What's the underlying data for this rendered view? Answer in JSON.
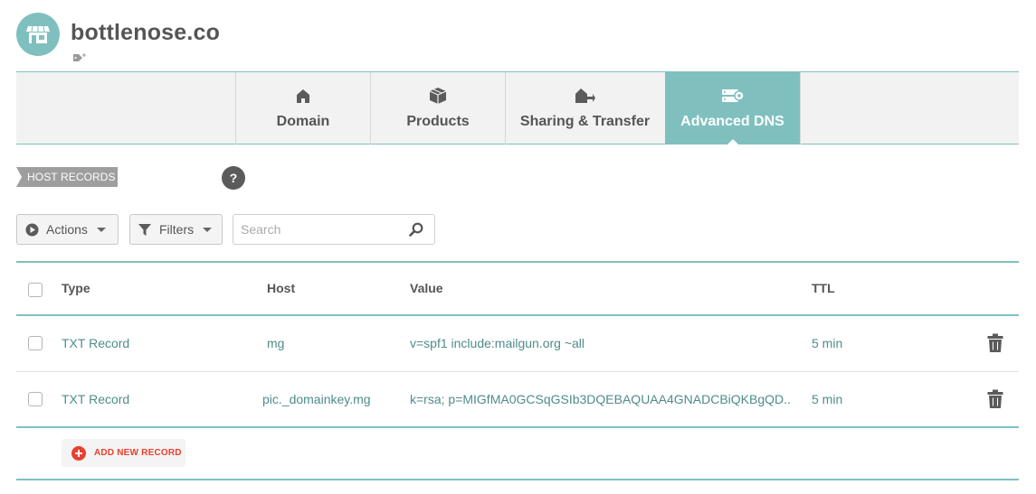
{
  "domain": {
    "name": "bottlenose.co"
  },
  "tabs": [
    {
      "label": "Domain",
      "icon": "home-icon",
      "active": false
    },
    {
      "label": "Products",
      "icon": "box-icon",
      "active": false
    },
    {
      "label": "Sharing & Transfer",
      "icon": "house-transfer-icon",
      "active": false
    },
    {
      "label": "Advanced DNS",
      "icon": "server-gear-icon",
      "active": true
    }
  ],
  "section": {
    "label": "HOST RECORDS",
    "help": "?"
  },
  "toolbar": {
    "actions_label": "Actions",
    "filters_label": "Filters",
    "search_placeholder": "Search",
    "search_value": ""
  },
  "table": {
    "headers": {
      "type": "Type",
      "host": "Host",
      "value": "Value",
      "ttl": "TTL"
    },
    "rows": [
      {
        "type": "TXT Record",
        "host": "mg",
        "value": "v=spf1 include:mailgun.org ~all",
        "ttl": "5 min"
      },
      {
        "type": "TXT Record",
        "host": "pic._domainkey.mg",
        "value": "k=rsa; p=MIGfMA0GCSqGSIb3DQEBAQUAA4GNADCBiQKBgQD..",
        "ttl": "5 min"
      }
    ],
    "add_label": "ADD NEW RECORD"
  },
  "colors": {
    "accent": "#7fc0bf",
    "link_text": "#4e8c8a",
    "danger": "#e8402e",
    "label_grey": "#9e9e9e"
  }
}
